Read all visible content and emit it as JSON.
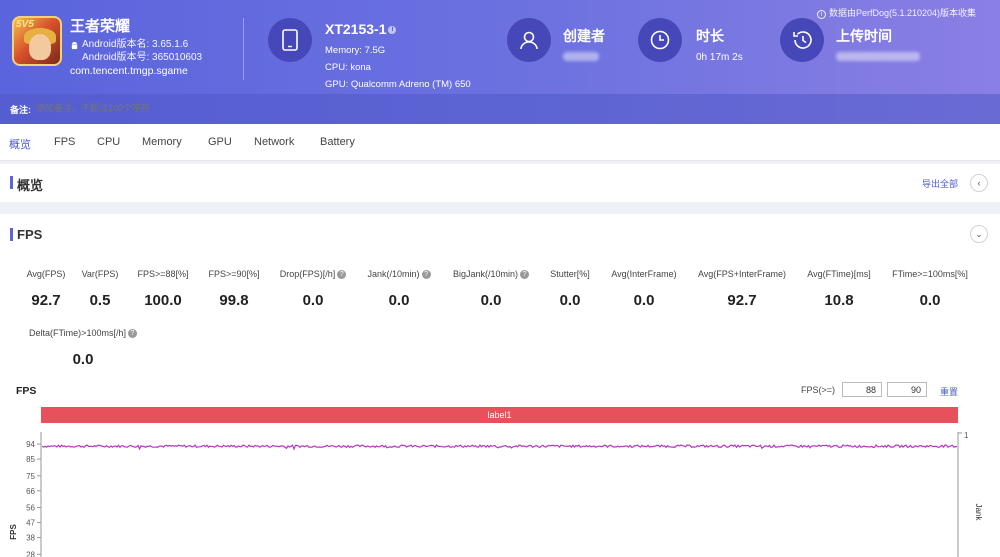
{
  "app": {
    "icon_badge": "5V5",
    "name": "王者荣耀",
    "version_name": "Android版本名: 3.65.1.6",
    "version_code": "Android版本号: 365010603",
    "package": "com.tencent.tmgp.sgame"
  },
  "device": {
    "name": "XT2153-1",
    "memory": "Memory: 7.5G",
    "cpu": "CPU: kona",
    "gpu": "GPU: Qualcomm Adreno (TM) 650"
  },
  "stats": {
    "creator_title": "创建者",
    "duration_title": "时长",
    "duration_value": "0h 17m 2s",
    "upload_title": "上传时间"
  },
  "source_note": "数据由PerfDog(5.1.210204)版本收集",
  "remark": {
    "label": "备注:",
    "placeholder": "添加备注，不超过200个字符"
  },
  "tabs": [
    "概览",
    "FPS",
    "CPU",
    "Memory",
    "GPU",
    "Network",
    "Battery"
  ],
  "active_tab": 0,
  "overview": {
    "title": "概览",
    "export_label": "导出全部"
  },
  "fps_section": {
    "title": "FPS",
    "metrics": [
      {
        "label": "Avg(FPS)",
        "value": "92.7"
      },
      {
        "label": "Var(FPS)",
        "value": "0.5"
      },
      {
        "label": "FPS>=88[%]",
        "value": "100.0"
      },
      {
        "label": "FPS>=90[%]",
        "value": "99.8"
      },
      {
        "label": "Drop(FPS)[/h]",
        "value": "0.0"
      },
      {
        "label": "Jank(/10min)",
        "value": "0.0"
      },
      {
        "label": "BigJank(/10min)",
        "value": "0.0"
      },
      {
        "label": "Stutter[%]",
        "value": "0.0"
      },
      {
        "label": "Avg(InterFrame)",
        "value": "0.0"
      },
      {
        "label": "Avg(FPS+InterFrame)",
        "value": "92.7"
      },
      {
        "label": "Avg(FTime)[ms]",
        "value": "10.8"
      },
      {
        "label": "FTime>=100ms[%]",
        "value": "0.0"
      },
      {
        "label": "Delta(FTime)>100ms[/h]",
        "value": "0.0"
      }
    ],
    "chart_title": "FPS",
    "threshold_label": "FPS(>=)",
    "threshold_1": "88",
    "threshold_2": "90",
    "reset_label": "重置",
    "label_bar": "label1"
  },
  "chart_data": {
    "type": "line",
    "title": "FPS",
    "ylabel": "FPS",
    "y2label": "Jank",
    "y_ticks": [
      94,
      85,
      75,
      66,
      56,
      47,
      38,
      28
    ],
    "y2_ticks": [
      1
    ],
    "series": [
      {
        "name": "FPS",
        "approx_mean": 92.7,
        "approx_min": 91.5,
        "approx_max": 94,
        "color": "#b03ab8"
      }
    ],
    "jank_markers": 0
  },
  "colors": {
    "accent": "#5a64dc",
    "label_bar": "#e8505b",
    "fps_line": "#b03ab8"
  }
}
